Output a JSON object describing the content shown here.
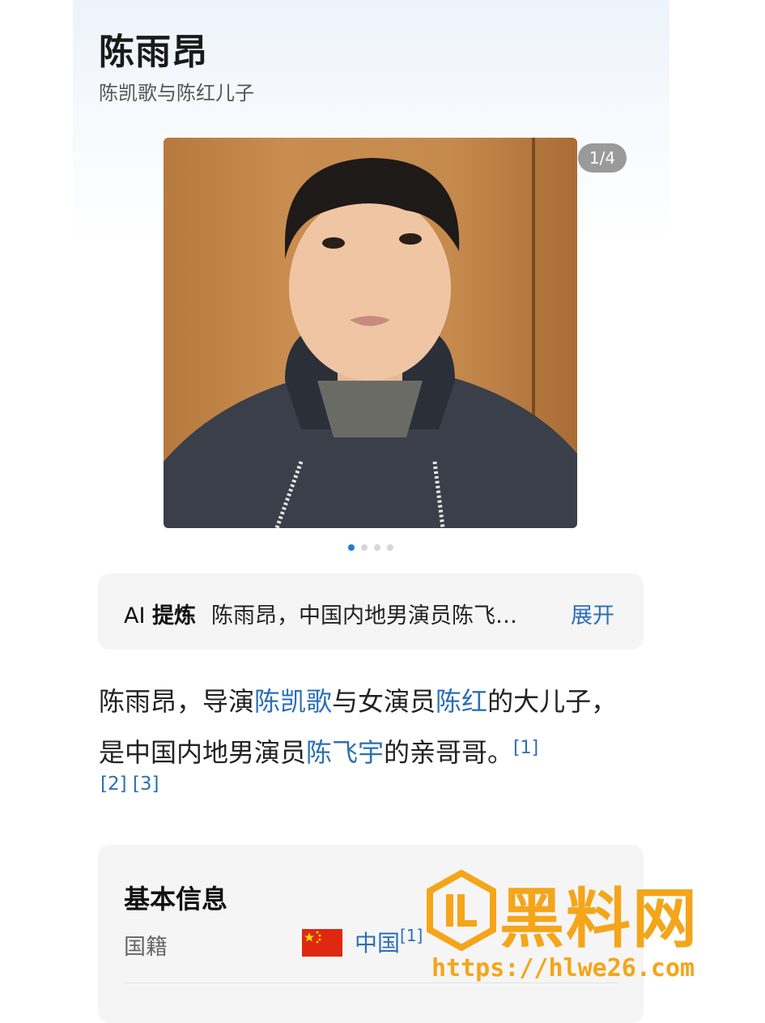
{
  "header": {
    "title": "陈雨昂",
    "subtitle": "陈凯歌与陈红儿子"
  },
  "gallery": {
    "counter": "1/4",
    "total_dots": 4,
    "active_dot": 1
  },
  "ai_summary": {
    "label_prefix": "AI",
    "label_bold": "提炼",
    "text": "陈雨昂，中国内地男演员陈飞…",
    "expand_label": "展开"
  },
  "intro": {
    "part1": "陈雨昂，导演",
    "link1": "陈凯歌",
    "part2": "与女演员",
    "link2": "陈红",
    "part3": "的大儿子，是中国内地男演员",
    "link3": "陈飞宇",
    "part4": "的亲哥哥。",
    "ref1": "[1]",
    "ref2": "[2]",
    "ref3": "[3]"
  },
  "basic_info": {
    "heading": "基本信息",
    "rows": [
      {
        "label": "国籍",
        "value": "中国",
        "ref": "[1]"
      }
    ]
  },
  "watermark": {
    "text": "黑料网",
    "url": "https://hlwe26.com"
  },
  "colors": {
    "link": "#2d6fb6",
    "dot_active": "#1a7fd4",
    "watermark": "#f4a51a"
  }
}
